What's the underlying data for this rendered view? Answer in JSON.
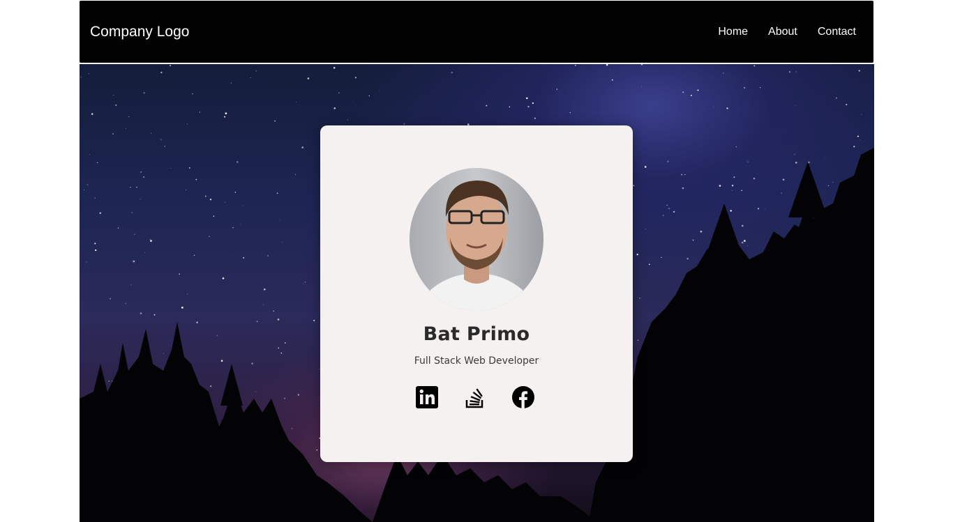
{
  "header": {
    "logo": "Company Logo",
    "nav": [
      {
        "label": "Home"
      },
      {
        "label": "About"
      },
      {
        "label": "Contact"
      }
    ]
  },
  "profile": {
    "name": "Bat Primo",
    "role": "Full Stack Web Developer",
    "socials": [
      {
        "icon": "linkedin-icon"
      },
      {
        "icon": "stackoverflow-icon"
      },
      {
        "icon": "facebook-icon"
      }
    ]
  },
  "colors": {
    "navbar": "#020202",
    "card": "#f5f1f1",
    "text": "#2a2a2a"
  }
}
